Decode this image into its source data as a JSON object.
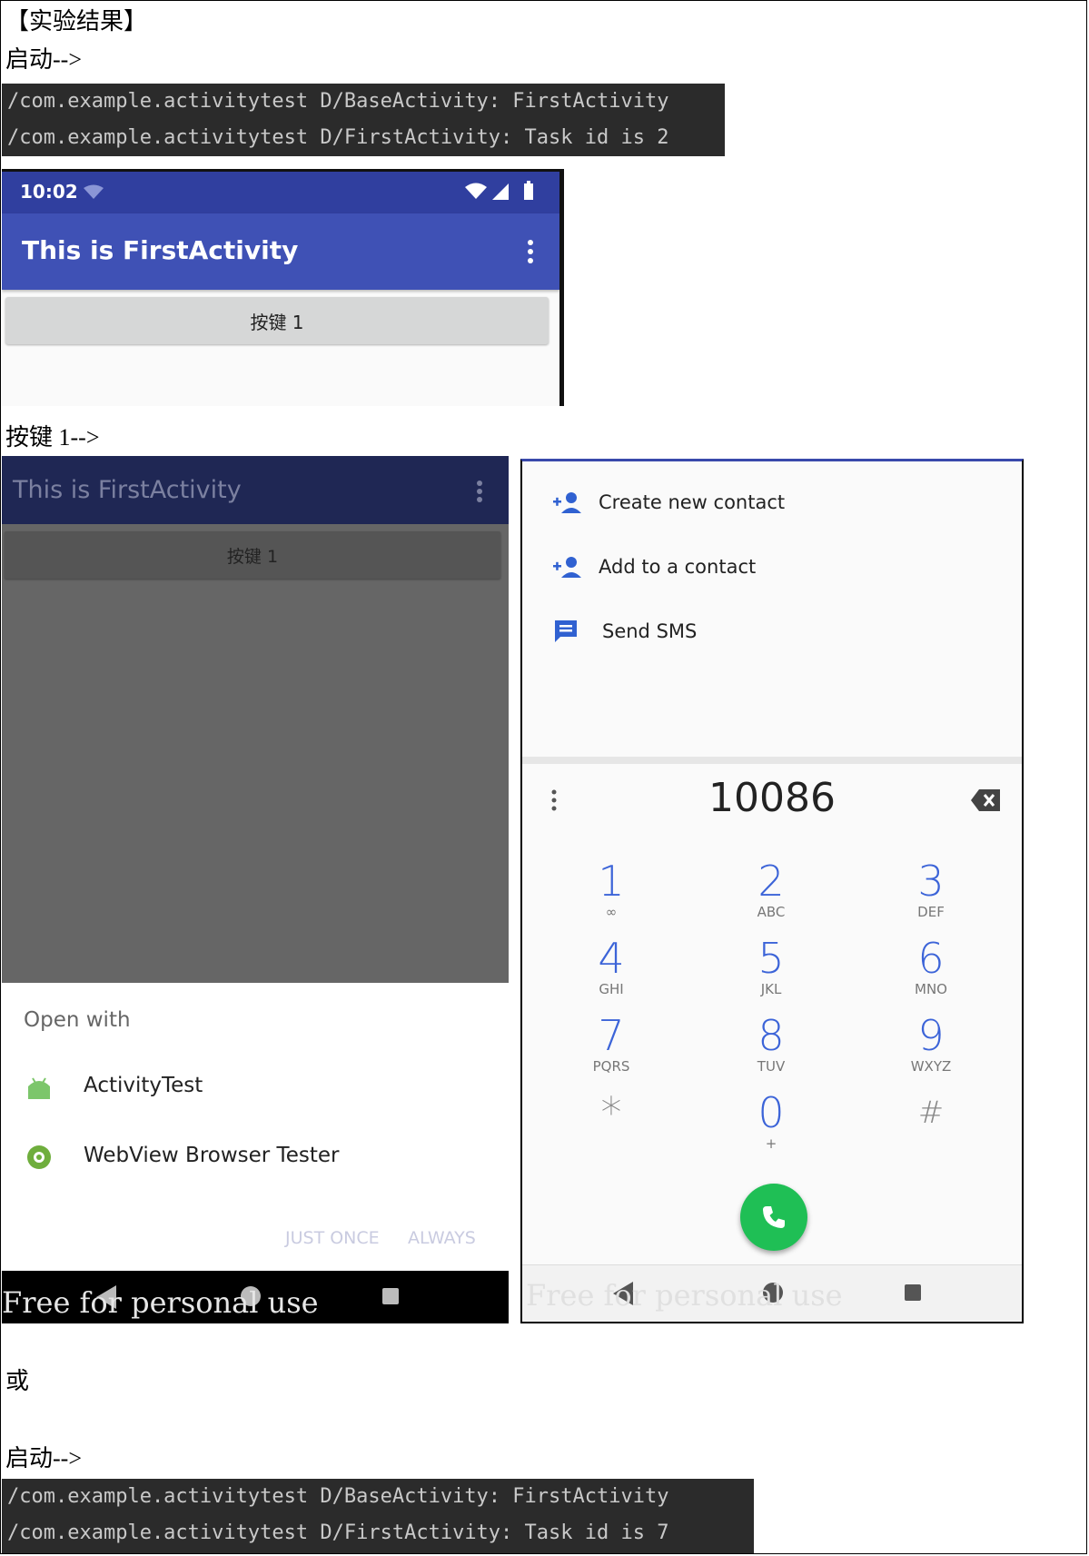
{
  "heading": "【实验结果】",
  "launch_label_1": "启动-->",
  "log1": [
    "/com.example.activitytest D/BaseActivity: FirstActivity",
    "/com.example.activitytest D/FirstActivity: Task id is 2"
  ],
  "phone1": {
    "time": "10:02",
    "title": "This is FirstActivity",
    "button": "按键 1"
  },
  "button_label": "按键 1-->",
  "phone2": {
    "title": "This is FirstActivity",
    "button": "按键 1",
    "open_with": "Open with",
    "apps": [
      "ActivityTest",
      "WebView Browser Tester"
    ],
    "just_once": "JUST ONCE",
    "always": "ALWAYS",
    "watermark": "Free for personal use"
  },
  "phone3": {
    "actions": [
      "Create new contact",
      "Add to a contact",
      "Send SMS"
    ],
    "number": "10086",
    "keys": [
      {
        "d": "1",
        "l": "∞"
      },
      {
        "d": "2",
        "l": "ABC"
      },
      {
        "d": "3",
        "l": "DEF"
      },
      {
        "d": "4",
        "l": "GHI"
      },
      {
        "d": "5",
        "l": "JKL"
      },
      {
        "d": "6",
        "l": "MNO"
      },
      {
        "d": "7",
        "l": "PQRS"
      },
      {
        "d": "8",
        "l": "TUV"
      },
      {
        "d": "9",
        "l": "WXYZ"
      },
      {
        "d": "*",
        "l": ""
      },
      {
        "d": "0",
        "l": "+"
      },
      {
        "d": "#",
        "l": ""
      }
    ],
    "watermark": "Free for personal use"
  },
  "or_label": "或",
  "launch_label_2": "启动-->",
  "log2": [
    "/com.example.activitytest D/BaseActivity: FirstActivity",
    "/com.example.activitytest D/FirstActivity: Task id is 7"
  ],
  "colors": {
    "primary": "#3f51b5",
    "primary_dark": "#303f9f",
    "dial_blue": "#3c64d8",
    "call_green": "#1fbf55"
  }
}
